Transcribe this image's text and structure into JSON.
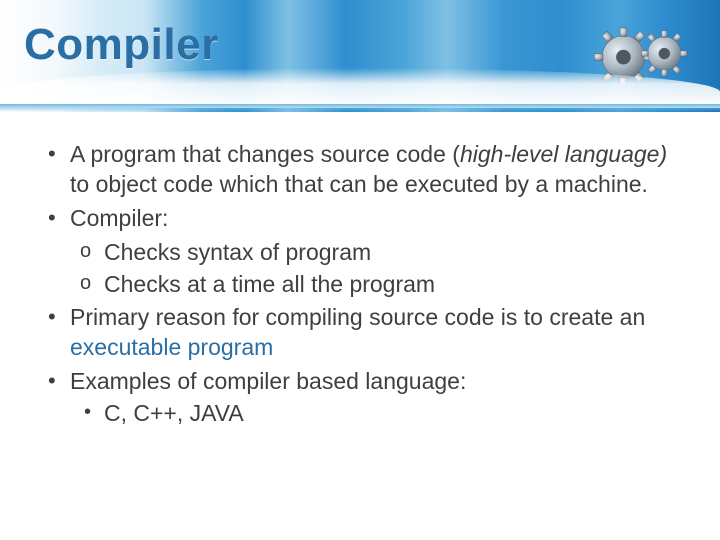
{
  "title": "Compiler",
  "bullets": {
    "b1_pre": "A program that changes source code (",
    "b1_italic": "high-level language)",
    "b1_post": " to object code which that can be executed by a machine.",
    "b2": "Compiler:",
    "b2_sub1": "Checks syntax of program",
    "b2_sub2": "Checks at a time all the program",
    "b3_pre": "Primary reason for compiling source code is to create an ",
    "b3_link": "executable program",
    "b4": "Examples of compiler based language:",
    "b4_sub1": "C, C++, JAVA"
  }
}
